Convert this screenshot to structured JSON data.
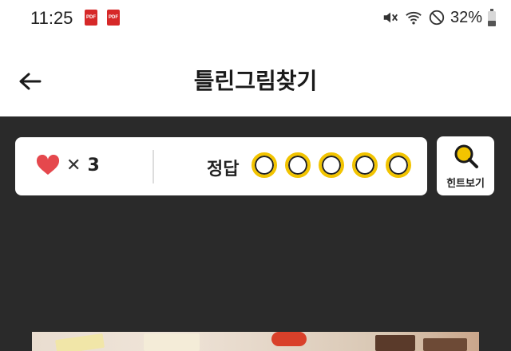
{
  "status_bar": {
    "time": "11:25",
    "notification_icons": [
      "pdf-icon",
      "pdf-icon"
    ],
    "pdf_label": "PDF",
    "system_icons": [
      "mute-icon",
      "wifi-icon",
      "do-not-disturb-icon",
      "battery-icon"
    ],
    "battery": "32%"
  },
  "header": {
    "title": "틀린그림찾기",
    "back_icon": "arrow-left-icon"
  },
  "score": {
    "lives_icon": "heart-icon",
    "times_symbol": "✕",
    "lives": "3",
    "answer_label": "정답",
    "answers_found": 0,
    "answers_total": 5
  },
  "hint": {
    "label": "힌트보기",
    "icon": "magnifier-icon"
  },
  "colors": {
    "game_background": "#2a2a2a",
    "heart": "#e5484d",
    "answer_circle": "#f2c400"
  }
}
